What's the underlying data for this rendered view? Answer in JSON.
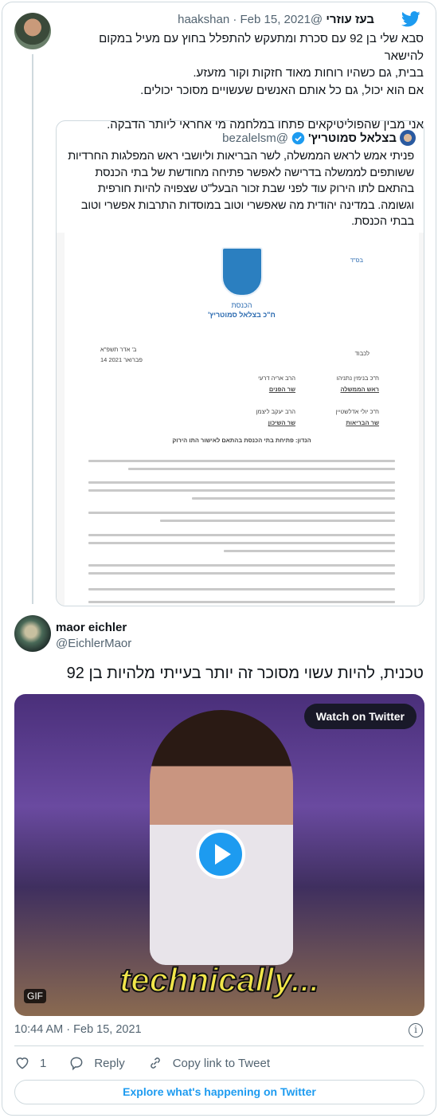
{
  "tweet": {
    "author_name": "בעז עוזרי",
    "handle": "@haakshan",
    "date": "Feb 15, 2021",
    "lines": [
      "סבא שלי בן 92 עם סכרת ומתעקש להתפלל בחוץ עם מעיל במקום להישאר",
      "בבית, גם כשהיו רוחות מאוד חזקות וקור מזעזע.",
      "אם הוא יכול, גם כל אותם האנשים שעשויים מסוכר יכולים.",
      "",
      "אני מבין שהפוליטיקאים פתחו במלחמה מי אחראי ליותר הדבקה."
    ]
  },
  "quote": {
    "author_name": "בצלאל סמוטריץ'",
    "handle": "@bezalelsm",
    "verified": true,
    "lines": [
      "פניתי אמש לראש הממשלה, לשר הבריאות וליושבי ראש המפלגות החרדיות",
      "ששותפים לממשלה בדרישה לאפשר פתיחה מחודשת של בתי הכנסת",
      "בהתאם לתו הירוק עוד לפני שבת זכור הבעל\"ט שצפויה להיות חורפית",
      "וגשומה. במדינה יהודית מה שאפשרי וטוב במוסדות התרבות אפשרי וטוב",
      "בבתי הכנסת."
    ],
    "document": {
      "bsd": "בס\"ד",
      "org": "הכנסת",
      "mk": "ח\"כ בצלאל סמוטריץ'",
      "date_hebrew": "ב' אדר תשפ\"א",
      "date": "14 פברואר 2021",
      "to": "לכבוד",
      "recipients": [
        {
          "name": "ח\"כ בנימין נתניהו",
          "title": "ראש הממשלה"
        },
        {
          "name": "הרב אריה דרעי",
          "title": "שר הפנים"
        },
        {
          "name": "ח\"כ יולי אדלשטיין",
          "title": "שר הבריאות"
        },
        {
          "name": "הרב יעקב ליצמן",
          "title": "שר השיכון"
        }
      ],
      "subject": "הנדון: פתיחת בתי הכנסת בהתאם לאישור התו הירוק"
    }
  },
  "reply": {
    "author_name": "maor eichler",
    "handle": "@EichlerMaor",
    "text": "טכנית, להיות עשוי מסוכר זה יותר בעייתי מלהיות בן 92",
    "media": {
      "watch_label": "Watch on Twitter",
      "badge": "GIF",
      "caption": "technically..."
    },
    "timestamp": "10:44 AM · Feb 15, 2021",
    "likes": "1",
    "reply_label": "Reply",
    "copy_label": "Copy link to Tweet",
    "explore_label": "Explore what's happening on Twitter"
  },
  "colors": {
    "accent": "#1d9bf0",
    "text": "#0f1419",
    "muted": "#536471",
    "border": "#cfd9de"
  }
}
